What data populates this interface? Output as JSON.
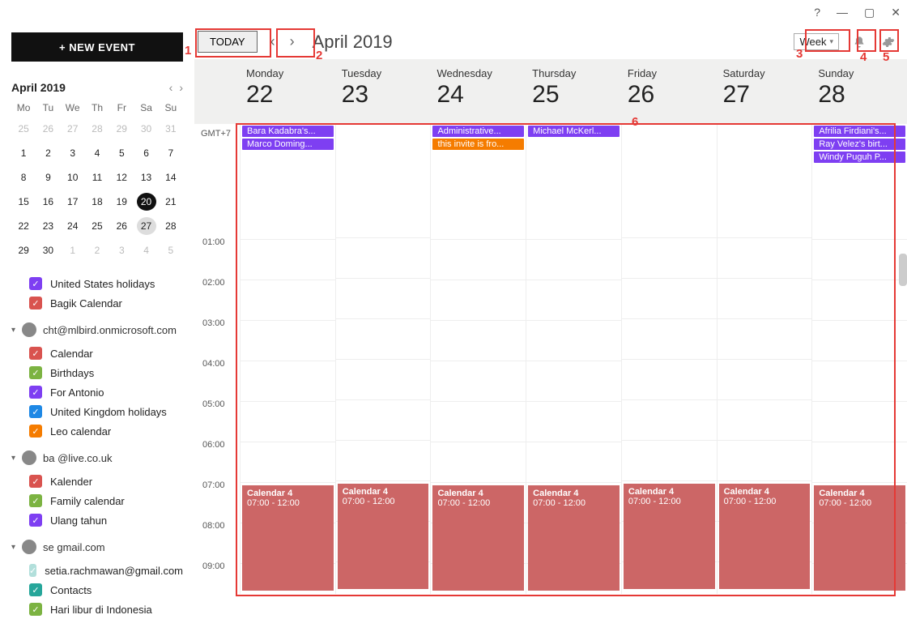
{
  "window_controls": {
    "help": "?",
    "min": "—",
    "max": "▢",
    "close": "✕"
  },
  "new_event_label": "+ NEW EVENT",
  "mini": {
    "title": "April 2019",
    "dow": [
      "Mo",
      "Tu",
      "We",
      "Th",
      "Fr",
      "Sa",
      "Su"
    ],
    "leading_dim": [
      25,
      26,
      27,
      28,
      29,
      30,
      31
    ],
    "weeks": [
      [
        1,
        2,
        3,
        4,
        5,
        6,
        7
      ],
      [
        8,
        9,
        10,
        11,
        12,
        13,
        14
      ],
      [
        15,
        16,
        17,
        18,
        19,
        20,
        21
      ],
      [
        22,
        23,
        24,
        25,
        26,
        27,
        28
      ],
      [
        29,
        30,
        1,
        2,
        3,
        4,
        5
      ]
    ],
    "today": 20,
    "selected": 27
  },
  "calendars": {
    "top_loose": [
      {
        "label": "United States holidays",
        "color": "c-purple"
      },
      {
        "label": "Bagik Calendar",
        "color": "c-red"
      }
    ],
    "accounts": [
      {
        "name": "cht@mlbird.onmicrosoft.com",
        "avatar": "●",
        "items": [
          {
            "label": "Calendar",
            "color": "c-red"
          },
          {
            "label": "Birthdays",
            "color": "c-green"
          },
          {
            "label": "For Antonio",
            "color": "c-purple"
          },
          {
            "label": "United Kingdom holidays",
            "color": "c-blue"
          },
          {
            "label": "Leo calendar",
            "color": "c-orange"
          }
        ]
      },
      {
        "name": "ba                  @live.co.uk",
        "avatar": "●",
        "items": [
          {
            "label": "Kalender",
            "color": "c-red"
          },
          {
            "label": "Family calendar",
            "color": "c-green"
          },
          {
            "label": "Ulang tahun",
            "color": "c-purple"
          }
        ]
      },
      {
        "name": "se                  gmail.com",
        "avatar": "◐",
        "items": [
          {
            "label": "setia.rachmawan@gmail.com",
            "color": "c-teal"
          },
          {
            "label": "Contacts",
            "color": "c-tealfill"
          },
          {
            "label": "Hari libur di Indonesia",
            "color": "c-green"
          }
        ]
      }
    ]
  },
  "toolbar": {
    "today": "TODAY",
    "month_title": "April 2019",
    "view": "Week"
  },
  "tz": "GMT+7",
  "days": [
    {
      "dow": "Monday",
      "num": "22"
    },
    {
      "dow": "Tuesday",
      "num": "23"
    },
    {
      "dow": "Wednesday",
      "num": "24"
    },
    {
      "dow": "Thursday",
      "num": "25"
    },
    {
      "dow": "Friday",
      "num": "26"
    },
    {
      "dow": "Saturday",
      "num": "27"
    },
    {
      "dow": "Sunday",
      "num": "28"
    }
  ],
  "allday": [
    [
      {
        "t": "Bara Kadabra's...",
        "c": "p"
      },
      {
        "t": "Marco Doming...",
        "c": "p"
      }
    ],
    [],
    [
      {
        "t": "Administrative...",
        "c": "p"
      },
      {
        "t": "this invite is fro...",
        "c": "o"
      }
    ],
    [
      {
        "t": "Michael McKerl...",
        "c": "p"
      }
    ],
    [],
    [],
    [
      {
        "t": "Afrilia Firdiani's...",
        "c": "p"
      },
      {
        "t": "Ray Velez's birt...",
        "c": "p"
      },
      {
        "t": "Windy Puguh P...",
        "c": "p"
      }
    ]
  ],
  "hours": [
    "01:00",
    "02:00",
    "03:00",
    "04:00",
    "05:00",
    "06:00",
    "07:00",
    "08:00",
    "09:00"
  ],
  "timed_event": {
    "title": "Calendar 4",
    "sub": "07:00 - 12:00"
  },
  "annot": {
    "1": "1",
    "2": "2",
    "3": "3",
    "4": "4",
    "5": "5",
    "6": "6"
  }
}
